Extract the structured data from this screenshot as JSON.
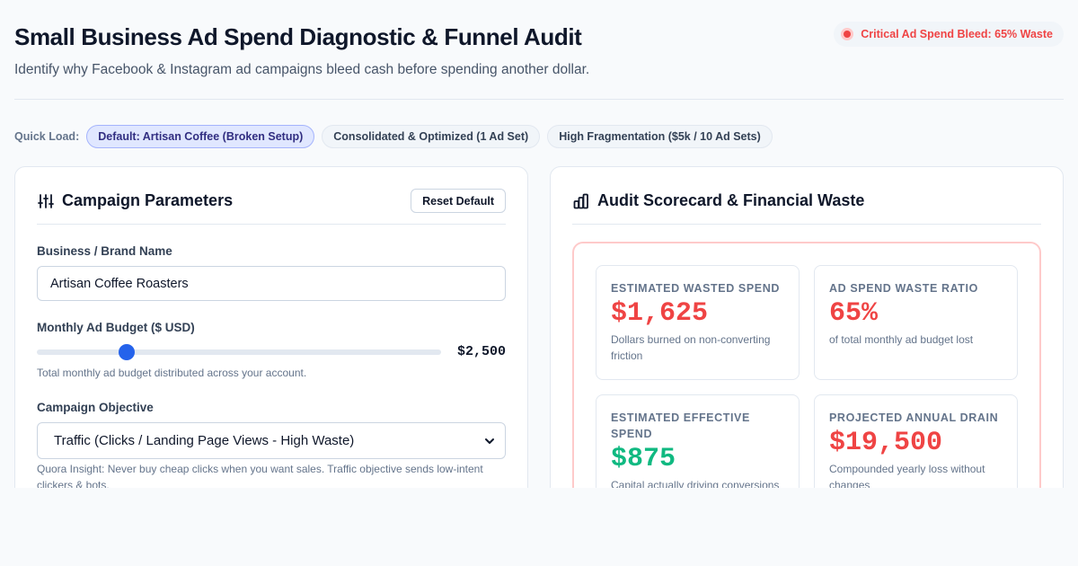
{
  "header": {
    "title": "Small Business Ad Spend Diagnostic & Funnel Audit",
    "subtitle": "Identify why Facebook & Instagram ad campaigns bleed cash before spending another dollar.",
    "alert": "Critical Ad Spend Bleed: 65% Waste"
  },
  "quick_load": {
    "label": "Quick Load:",
    "presets": [
      "Default: Artisan Coffee (Broken Setup)",
      "Consolidated & Optimized (1 Ad Set)",
      "High Fragmentation ($5k / 10 Ad Sets)"
    ],
    "active": 0
  },
  "params": {
    "title": "Campaign Parameters",
    "reset_label": "Reset Default",
    "brand_label": "Business / Brand Name",
    "brand_value": "Artisan Coffee Roasters",
    "budget_label": "Monthly Ad Budget ($ USD)",
    "budget_value": "$2,500",
    "budget_fraction": 0.222,
    "budget_helper": "Total monthly ad budget distributed across your account.",
    "objective_label": "Campaign Objective",
    "objective_value": "Traffic (Clicks / Landing Page Views - High Waste)",
    "objective_helper": "Quora Insight: Never buy cheap clicks when you want sales. Traffic objective sends low-intent clickers & bots."
  },
  "scorecard": {
    "title": "Audit Scorecard & Financial Waste",
    "metrics": [
      {
        "label": "ESTIMATED WASTED SPEND",
        "value": "$1,625",
        "desc": "Dollars burned on non-converting friction"
      },
      {
        "label": "AD SPEND WASTE RATIO",
        "value": "65%",
        "desc": "of total monthly ad budget lost"
      },
      {
        "label": "ESTIMATED EFFECTIVE SPEND",
        "value": "$875",
        "desc": "Capital actually driving conversions"
      },
      {
        "label": "PROJECTED ANNUAL DRAIN",
        "value": "$19,500",
        "desc": "Compounded yearly loss without changes"
      }
    ]
  },
  "colors": {
    "accent": "#2563eb",
    "danger": "#ef4444",
    "success": "#10b981"
  }
}
